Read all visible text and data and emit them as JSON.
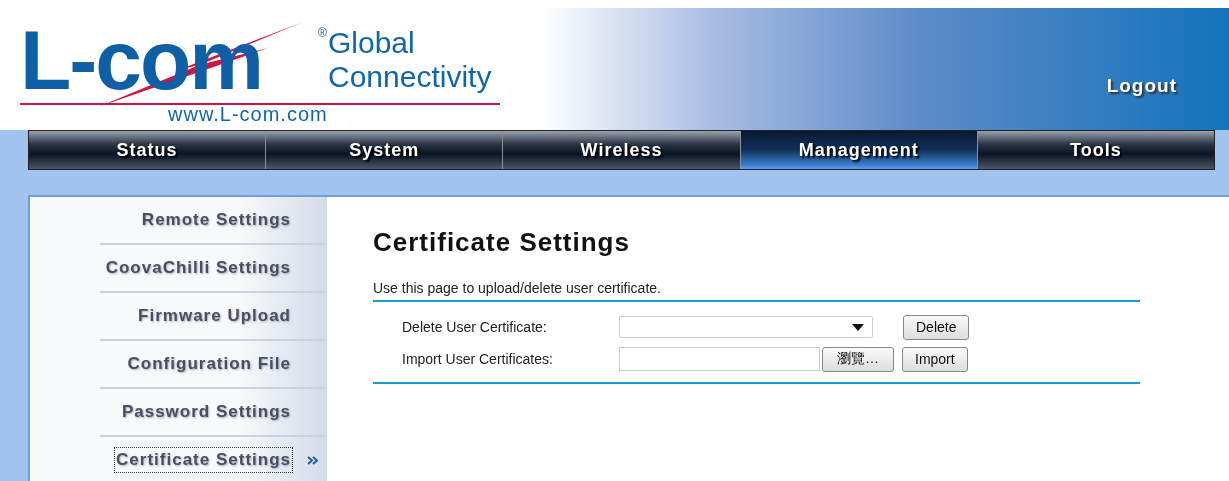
{
  "header": {
    "logo": {
      "mark": "L-com",
      "registered": "®",
      "tagline": [
        "Global",
        "Connectivity"
      ],
      "url": "www.L-com.com"
    },
    "logout": "Logout"
  },
  "nav": [
    {
      "label": "Status",
      "selected": false
    },
    {
      "label": "System",
      "selected": false
    },
    {
      "label": "Wireless",
      "selected": false
    },
    {
      "label": "Management",
      "selected": true
    },
    {
      "label": "Tools",
      "selected": false
    }
  ],
  "sidebar": {
    "items": [
      {
        "label": "Remote Settings",
        "selected": false
      },
      {
        "label": "CoovaChilli Settings",
        "selected": false
      },
      {
        "label": "Firmware Upload",
        "selected": false
      },
      {
        "label": "Configuration File",
        "selected": false
      },
      {
        "label": "Password Settings",
        "selected": false
      },
      {
        "label": "Certificate Settings",
        "selected": true
      }
    ]
  },
  "content": {
    "title": "Certificate Settings",
    "description": "Use this page to upload/delete user certificate.",
    "rows": [
      {
        "kind": "select",
        "label": "Delete User Certificate:",
        "button": "Delete"
      },
      {
        "kind": "file",
        "label": "Import User Certificates:",
        "browse": "瀏覽…",
        "button": "Import"
      }
    ]
  }
}
